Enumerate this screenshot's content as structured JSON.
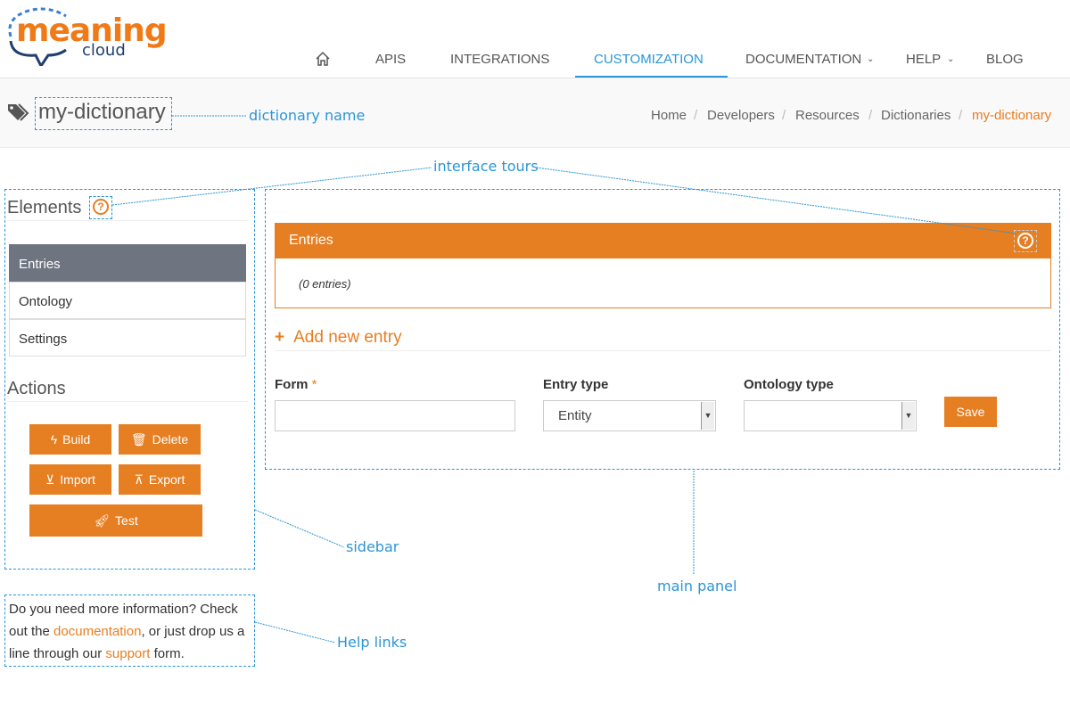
{
  "logo": {
    "line1": "meaning",
    "line2": "cloud"
  },
  "nav": {
    "items": [
      "APIS",
      "INTEGRATIONS",
      "CUSTOMIZATION",
      "DOCUMENTATION",
      "HELP",
      "BLOG"
    ],
    "active": "CUSTOMIZATION"
  },
  "page": {
    "title": "my-dictionary"
  },
  "breadcrumb": [
    "Home",
    "Developers",
    "Resources",
    "Dictionaries",
    "my-dictionary"
  ],
  "sidebar": {
    "elements_heading": "Elements",
    "items": [
      "Entries",
      "Ontology",
      "Settings"
    ],
    "active": "Entries",
    "actions_heading": "Actions",
    "buttons": {
      "build": "Build",
      "delete": "Delete",
      "import": "Import",
      "export": "Export",
      "test": "Test"
    }
  },
  "panel": {
    "title": "Entries",
    "count": "(0 entries)",
    "add_new": "Add new entry",
    "form_label": "Form",
    "required": "*",
    "entry_type_label": "Entry type",
    "entry_type_value": "Entity",
    "ontology_type_label": "Ontology type",
    "ontology_type_value": "",
    "save": "Save"
  },
  "help": {
    "t1": "Do you need more information? Check out the ",
    "link1": "documentation",
    "t2": ", or just drop us a line through our ",
    "link2": "support",
    "t3": " form."
  },
  "annotations": {
    "dictionary_name": "dictionary name",
    "interface_tours": "interface tours",
    "sidebar": "sidebar",
    "main_panel": "main panel",
    "help_links": "Help links"
  },
  "colors": {
    "accent": "#e67e22",
    "nav_active": "#2b95d6",
    "annotation": "#2b95d6"
  }
}
